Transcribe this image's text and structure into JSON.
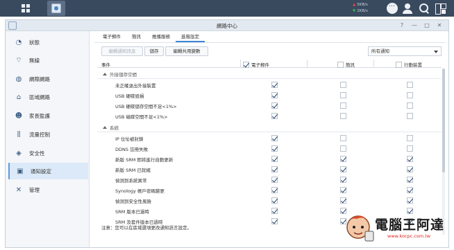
{
  "taskbar": {
    "upload_speed": "5KB/s",
    "download_speed": "2KB/s",
    "icons": [
      "main-menu-grid-icon",
      "network-center-app-icon",
      "chat-icon",
      "user-icon",
      "search-icon",
      "widgets-icon"
    ]
  },
  "window": {
    "title": "網路中心",
    "controls": [
      "?",
      "—",
      "□",
      "✕"
    ]
  },
  "sidebar": {
    "items": [
      {
        "label": "狀態",
        "icon": "gauge-icon",
        "glyph": "◔",
        "active": false
      },
      {
        "label": "無線",
        "icon": "wifi-icon",
        "glyph": "⌔",
        "active": false
      },
      {
        "label": "網際網路",
        "icon": "globe-icon",
        "glyph": "◍",
        "active": false
      },
      {
        "label": "區域網路",
        "icon": "home-network-icon",
        "glyph": "⌂",
        "active": false
      },
      {
        "label": "家長監護",
        "icon": "family-icon",
        "glyph": "☻",
        "active": false
      },
      {
        "label": "流量控制",
        "icon": "traffic-sliders-icon",
        "glyph": "⫼",
        "active": false
      },
      {
        "label": "安全性",
        "icon": "shield-icon",
        "glyph": "◈",
        "active": false
      },
      {
        "label": "通知設定",
        "icon": "notification-icon",
        "glyph": "▣",
        "active": true
      },
      {
        "label": "管理",
        "icon": "tools-icon",
        "glyph": "✕",
        "active": false
      }
    ]
  },
  "tabs": [
    {
      "label": "電子郵件",
      "active": false
    },
    {
      "label": "簡訊",
      "active": false
    },
    {
      "label": "推播服務",
      "active": false
    },
    {
      "label": "進階設定",
      "active": true
    }
  ],
  "toolbar": {
    "edit_label": "編輯通知訊息",
    "save_label": "儲存",
    "params_label": "編輯共用變數",
    "filter_selected": "所有通知"
  },
  "table": {
    "columns": {
      "event": "事件",
      "email": "電子郵件",
      "sms": "簡訊",
      "mobile": "行動裝置"
    },
    "header_checked": [
      true,
      false,
      false
    ],
    "groups": [
      {
        "name": "外接儲存空間",
        "rows": [
          {
            "label": "未正確退出外接裝置",
            "checks": [
              true,
              false,
              false
            ]
          },
          {
            "label": "USB 硬碟毀損",
            "checks": [
              true,
              false,
              false
            ]
          },
          {
            "label": "USB 硬碟儲存空間不足<1%>",
            "checks": [
              true,
              false,
              false
            ]
          },
          {
            "label": "USB 磁碟空間不足<1%>",
            "checks": [
              true,
              false,
              false
            ]
          }
        ]
      },
      {
        "name": "系統",
        "rows": [
          {
            "label": "IP 位址被封鎖",
            "checks": [
              true,
              false,
              false
            ]
          },
          {
            "label": "DDNS 註冊失敗",
            "checks": [
              true,
              false,
              false
            ]
          },
          {
            "label": "新版 SRM 即將進行自動更新",
            "checks": [
              true,
              true,
              true
            ]
          },
          {
            "label": "新版 SRM 已就緒",
            "checks": [
              true,
              true,
              true
            ]
          },
          {
            "label": "偵測到系統異常",
            "checks": [
              true,
              true,
              true
            ]
          },
          {
            "label": "Synology 帳戶密碼變更",
            "checks": [
              true,
              true,
              true
            ]
          },
          {
            "label": "偵測到安全性風險",
            "checks": [
              true,
              true,
              true
            ]
          },
          {
            "label": "SRM 版本已過時",
            "checks": [
              true,
              true,
              true
            ]
          },
          {
            "label": "SRM 及套件版本已過時",
            "checks": [
              true,
              true,
              true
            ]
          }
        ]
      }
    ]
  },
  "footer": {
    "note": "注意：您可以在區域選項更改通知語言設定。"
  },
  "watermark": {
    "text": "電腦王阿達",
    "url": "www.kocpc.com.tw"
  }
}
